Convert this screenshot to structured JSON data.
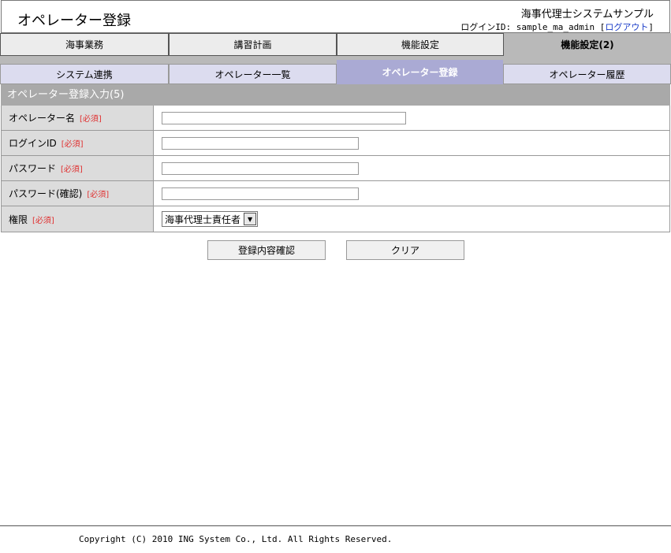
{
  "header": {
    "page_title": "オペレーター登録",
    "system_name": "海事代理士システムサンプル",
    "login_prefix": "ログインID: sample_ma_admin [",
    "logout_label": "ログアウト",
    "login_suffix": "]"
  },
  "main_nav": {
    "tabs": [
      {
        "label": "海事業務",
        "active": false
      },
      {
        "label": "講習計画",
        "active": false
      },
      {
        "label": "機能設定",
        "active": false
      },
      {
        "label": "機能設定(2)",
        "active": true
      }
    ]
  },
  "sub_nav": {
    "tabs": [
      {
        "label": "システム連携",
        "active": false
      },
      {
        "label": "オペレーター一覧",
        "active": false
      },
      {
        "label": "オペレーター登録",
        "active": true
      },
      {
        "label": "オペレーター履歴",
        "active": false
      }
    ]
  },
  "form": {
    "title": "オペレーター登録入力(5)",
    "required_mark": "[必須]",
    "fields": [
      {
        "label": "オペレーター名",
        "value": "",
        "placeholder": ""
      },
      {
        "label": "ログインID",
        "value": "",
        "placeholder": ""
      },
      {
        "label": "パスワード",
        "value": "",
        "placeholder": ""
      },
      {
        "label": "パスワード(確認)",
        "value": "",
        "placeholder": ""
      },
      {
        "label": "権限",
        "selected": "海事代理士責任者"
      }
    ],
    "confirm_button": "登録内容確認",
    "clear_button": "クリア"
  },
  "footer": {
    "copyright": "Copyright (C) 2010 ING System Co., Ltd. All Rights Reserved."
  }
}
